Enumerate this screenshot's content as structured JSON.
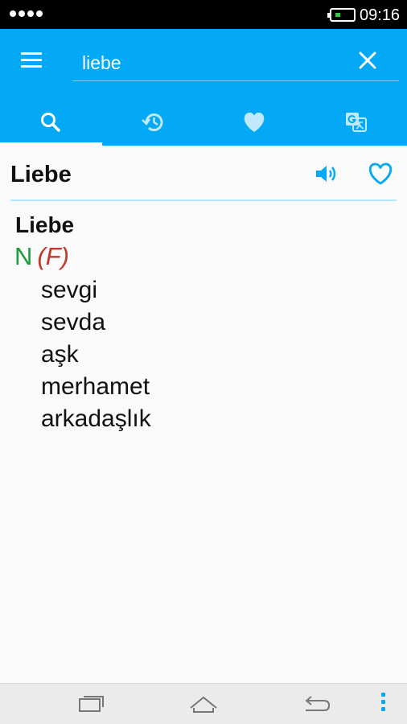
{
  "status_bar": {
    "time": "09:16"
  },
  "search": {
    "query": "liebe"
  },
  "tabs": [
    {
      "icon": "search-icon",
      "active": true
    },
    {
      "icon": "history-icon",
      "active": false
    },
    {
      "icon": "heart-icon",
      "active": false
    },
    {
      "icon": "translate-icon",
      "active": false
    }
  ],
  "result": {
    "title": "Liebe",
    "headword": "Liebe",
    "part_of_speech": "N",
    "gender": "(F)",
    "translations": [
      "sevgi",
      "sevda",
      "aşk",
      "merhamet",
      "arkadaşlık"
    ]
  },
  "colors": {
    "accent": "#03a9f4",
    "pos": "#1b9e3a",
    "gender": "#c0392b",
    "divider": "#b3e5fc"
  }
}
